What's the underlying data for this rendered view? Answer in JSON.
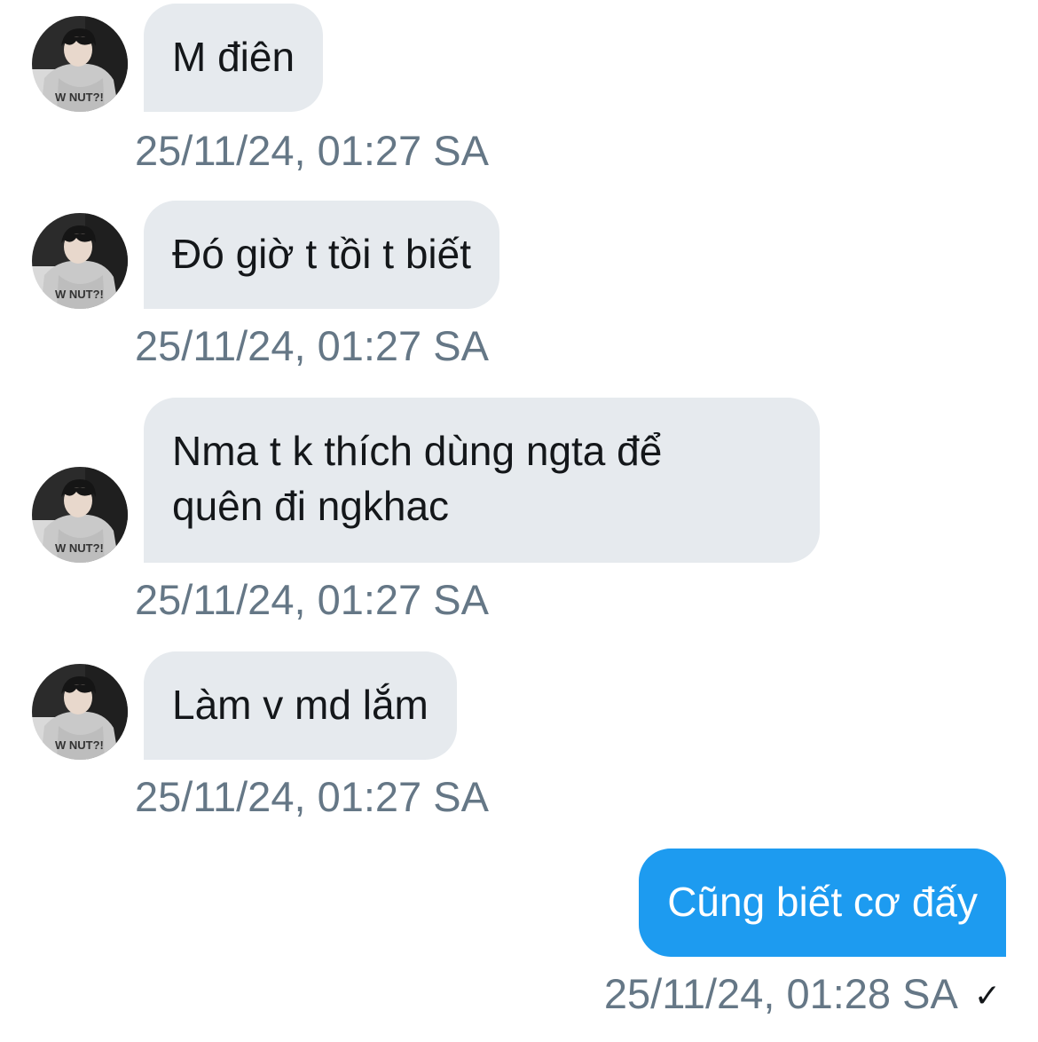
{
  "messages": [
    {
      "from": "other",
      "text": "M điên",
      "timestamp": "25/11/24, 01:27 SA"
    },
    {
      "from": "other",
      "text": "Đó giờ t tồi t biết",
      "timestamp": "25/11/24, 01:27 SA"
    },
    {
      "from": "other",
      "text": "Nma t k thích dùng ngta để\nquên đi ngkhac",
      "timestamp": "25/11/24, 01:27 SA"
    },
    {
      "from": "other",
      "text": "Làm v md lắm",
      "timestamp": "25/11/24, 01:27 SA"
    },
    {
      "from": "me",
      "text": "Cũng biết cơ đấy",
      "timestamp": "25/11/24, 01:28 SA",
      "status_icon": "check-icon"
    }
  ],
  "colors": {
    "incoming_bubble": "#e6eaee",
    "outgoing_bubble": "#1d9bf0",
    "timestamp": "#657786"
  },
  "avatar_icon": "profile-photo"
}
